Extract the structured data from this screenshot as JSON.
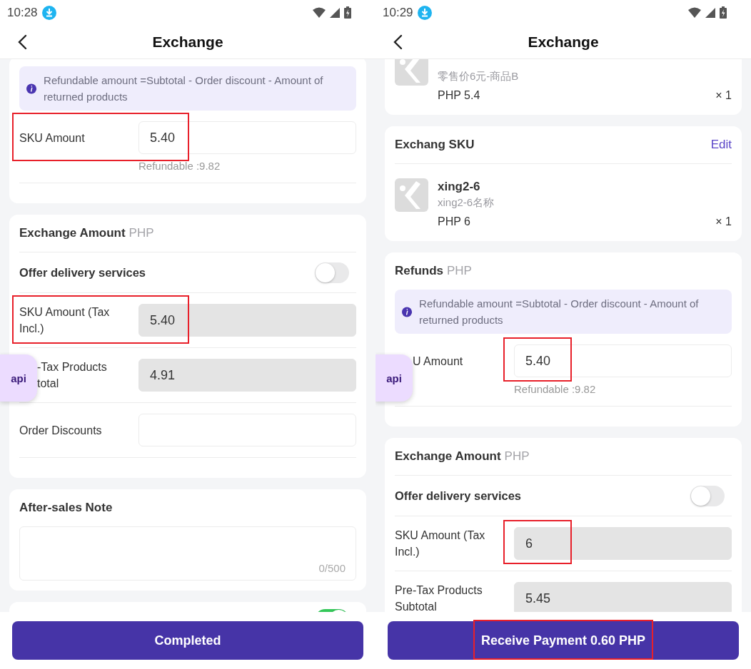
{
  "screens": [
    {
      "status_bar": {
        "time": "10:28"
      },
      "header": {
        "title": "Exchange"
      },
      "cards": [
        {
          "rows": [
            {
              "kind": "notice",
              "text": "Refundable amount =Subtotal - Order discount - Amount of returned products"
            },
            {
              "kind": "amount",
              "label": "SKU Amount",
              "value": "5.40",
              "disabled": false,
              "hint": "Refundable :9.82",
              "highlighted": true
            }
          ]
        },
        {
          "title": "Exchange Amount",
          "title_unit": "PHP",
          "rows": [
            {
              "kind": "toggle",
              "label": "Offer delivery services",
              "on": false
            },
            {
              "kind": "amount",
              "label": "SKU Amount (Tax Incl.)",
              "value": "5.40",
              "disabled": true,
              "highlighted": true
            },
            {
              "kind": "amount",
              "label": "-Tax Products\ntotal",
              "value": "4.91",
              "disabled": true
            },
            {
              "kind": "amount",
              "label": "Order Discounts",
              "disabled": false
            }
          ]
        },
        {
          "title": "After-sales Note",
          "rows": [
            {
              "kind": "note",
              "counter": "0/500"
            }
          ]
        },
        {
          "rows": [
            {
              "kind": "toggle",
              "on": true
            }
          ]
        }
      ],
      "floating_tab": "api",
      "footer_button": {
        "label": "Completed",
        "highlighted": false
      }
    },
    {
      "status_bar": {
        "time": "10:29"
      },
      "header": {
        "title": "Exchange"
      },
      "cards": [
        {
          "rows": [
            {
              "kind": "product",
              "subname": "零售价6元-商品B",
              "price": "PHP 5.4",
              "quantity": "× 1"
            }
          ]
        },
        {
          "title": "Exchang SKU",
          "action": "Edit",
          "rows": [
            {
              "kind": "product",
              "name": "xing2-6",
              "subname": "xing2-6名称",
              "price": "PHP 6",
              "quantity": "× 1"
            }
          ]
        },
        {
          "title": "Refunds",
          "title_unit": "PHP",
          "rows": [
            {
              "kind": "notice",
              "text": "Refundable amount =Subtotal - Order discount - Amount of returned products"
            },
            {
              "kind": "amount",
              "label": "U Amount",
              "value": "5.40",
              "disabled": false,
              "hint": "Refundable :9.82",
              "highlighted": true
            }
          ]
        },
        {
          "title": "Exchange Amount",
          "title_unit": "PHP",
          "rows": [
            {
              "kind": "toggle",
              "label": "Offer delivery services",
              "on": false
            },
            {
              "kind": "amount",
              "label": "SKU Amount (Tax Incl.)",
              "value": "6",
              "disabled": true,
              "highlighted": true
            },
            {
              "kind": "amount",
              "label": "Pre-Tax Products Subtotal",
              "value": "5.45",
              "disabled": true
            }
          ]
        }
      ],
      "floating_tab": "api",
      "footer_button": {
        "label": "Receive Payment 0.60 PHP",
        "highlighted": true
      }
    }
  ]
}
